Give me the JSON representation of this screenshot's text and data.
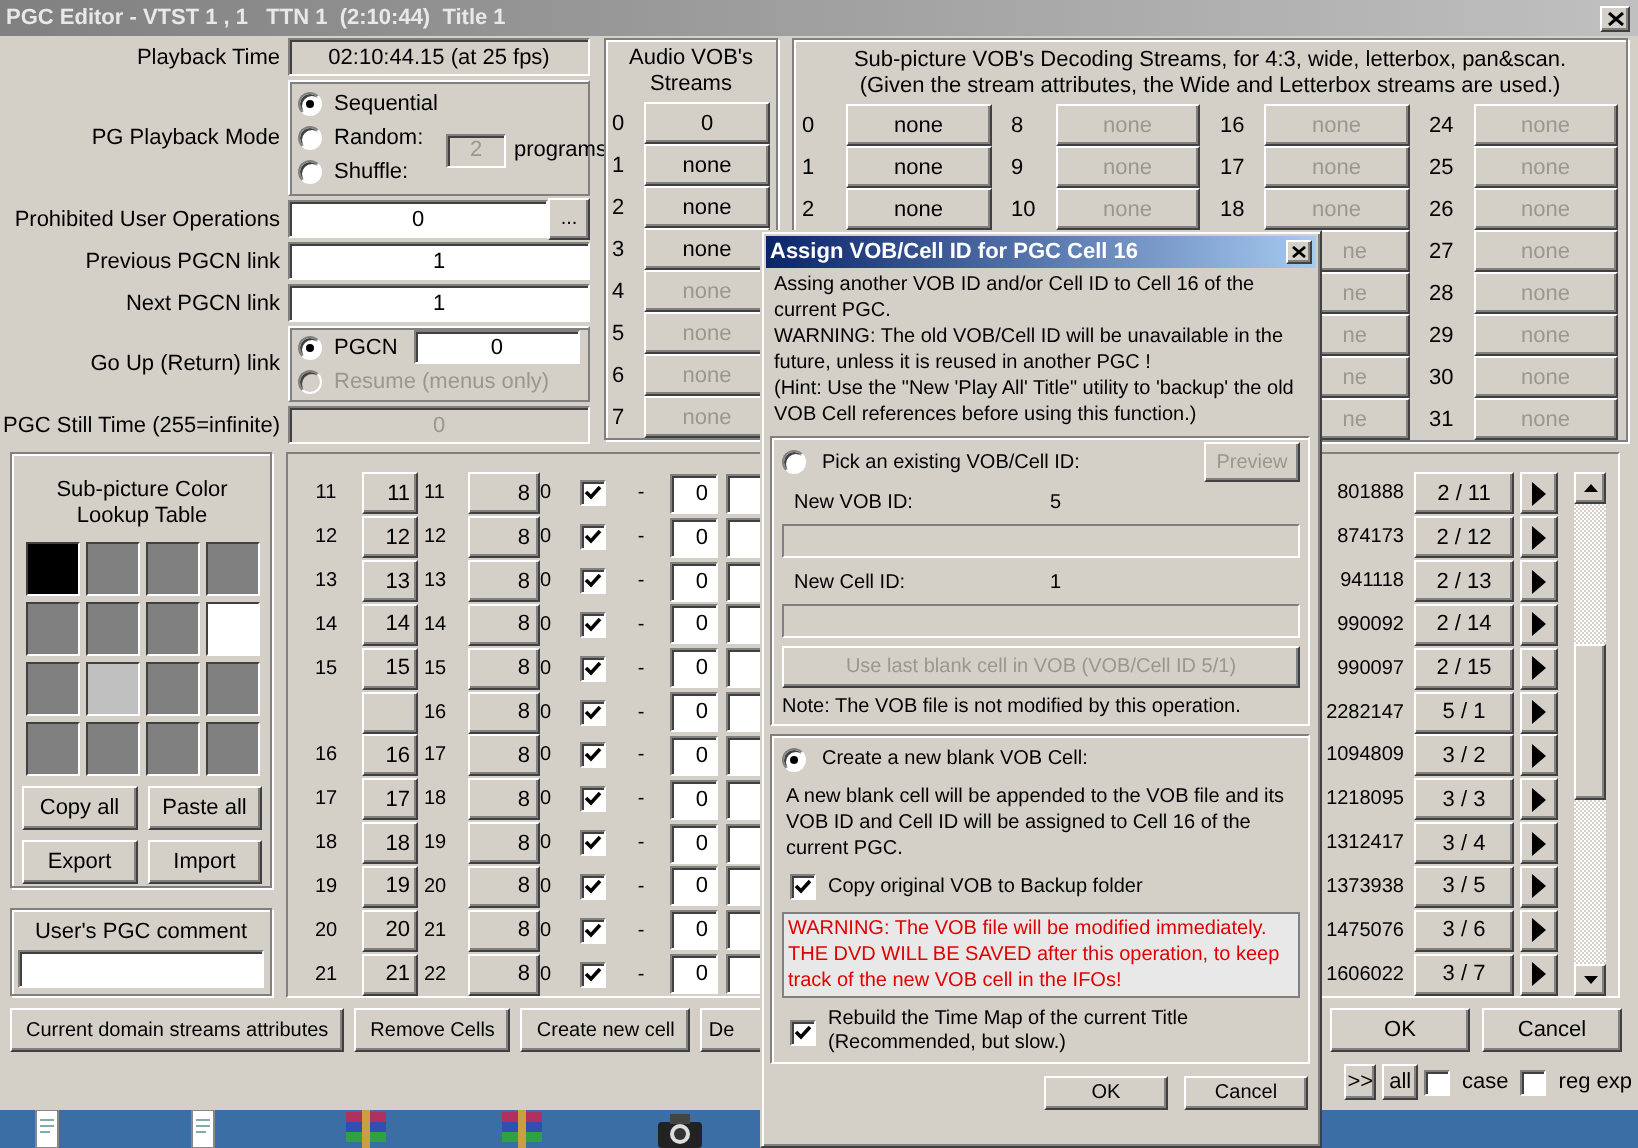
{
  "window": {
    "title": "PGC Editor - VTST 1 , 1   TTN 1  (2:10:44)  Title 1"
  },
  "properties": {
    "playback_time": {
      "label": "Playback Time",
      "value": "02:10:44.15 (at 25 fps)"
    },
    "playback_mode": {
      "label": "PG Playback Mode",
      "options": [
        {
          "label": "Sequential",
          "selected": true
        },
        {
          "label": "Random:",
          "selected": false
        },
        {
          "label": "Shuffle:",
          "selected": false
        }
      ],
      "programs": {
        "value": "2",
        "label": "programs",
        "disabled": true
      }
    },
    "prohibited_ops": {
      "label": "Prohibited User Operations",
      "value": "0",
      "button": "..."
    },
    "previous_link": {
      "label": "Previous PGCN link",
      "value": "1"
    },
    "next_link": {
      "label": "Next PGCN link",
      "value": "1"
    },
    "go_up": {
      "label": "Go Up (Return) link",
      "pgcn": {
        "label": "PGCN",
        "selected": true,
        "value": "0"
      },
      "resume": {
        "label": "Resume (menus only)",
        "selected": false,
        "disabled": true
      }
    },
    "still_time": {
      "label": "PGC Still Time (255=infinite)",
      "value": "0",
      "disabled": true
    }
  },
  "audio_streams": {
    "title": "Audio VOB's Streams",
    "streams": [
      {
        "index": "0",
        "label": "0",
        "disabled": false
      },
      {
        "index": "1",
        "label": "none",
        "disabled": false
      },
      {
        "index": "2",
        "label": "none",
        "disabled": false
      },
      {
        "index": "3",
        "label": "none",
        "disabled": false
      },
      {
        "index": "4",
        "label": "none",
        "disabled": true
      },
      {
        "index": "5",
        "label": "none",
        "disabled": true
      },
      {
        "index": "6",
        "label": "none",
        "disabled": true
      },
      {
        "index": "7",
        "label": "none",
        "disabled": true
      }
    ]
  },
  "subpicture_streams": {
    "title": "Sub-picture VOB's Decoding Streams, for 4:3, wide, letterbox, pan&scan.",
    "subtitle": "(Given the stream attributes, the Wide and Letterbox streams are used.)",
    "columns": [
      [
        {
          "kind": "button",
          "index": "0",
          "label": "none",
          "disabled": false
        },
        {
          "kind": "button",
          "index": "1",
          "label": "none",
          "disabled": false
        },
        {
          "kind": "button",
          "index": "2",
          "label": "none",
          "disabled": false
        }
      ],
      [
        {
          "kind": "button",
          "index": "8",
          "label": "none",
          "disabled": true
        },
        {
          "kind": "button",
          "index": "9",
          "label": "none",
          "disabled": true
        },
        {
          "kind": "button",
          "index": "10",
          "label": "none",
          "disabled": true
        }
      ],
      [
        {
          "kind": "button",
          "index": "16",
          "label": "none",
          "disabled": true
        },
        {
          "kind": "button",
          "index": "17",
          "label": "none",
          "disabled": true
        },
        {
          "kind": "button",
          "index": "18",
          "label": "none",
          "disabled": true
        },
        {
          "kind": "clipped",
          "label": "ne",
          "disabled": true
        },
        {
          "kind": "clipped",
          "label": "ne",
          "disabled": true
        },
        {
          "kind": "clipped",
          "label": "ne",
          "disabled": true
        },
        {
          "kind": "clipped",
          "label": "ne",
          "disabled": true
        },
        {
          "kind": "clipped",
          "label": "ne",
          "disabled": true
        }
      ],
      [
        {
          "kind": "button",
          "index": "24",
          "label": "none",
          "disabled": true
        },
        {
          "kind": "button",
          "index": "25",
          "label": "none",
          "disabled": true
        },
        {
          "kind": "button",
          "index": "26",
          "label": "none",
          "disabled": true
        },
        {
          "kind": "button",
          "index": "27",
          "label": "none",
          "disabled": true
        },
        {
          "kind": "button",
          "index": "28",
          "label": "none",
          "disabled": true
        },
        {
          "kind": "button",
          "index": "29",
          "label": "none",
          "disabled": true
        },
        {
          "kind": "button",
          "index": "30",
          "label": "none",
          "disabled": true
        },
        {
          "kind": "button",
          "index": "31",
          "label": "none",
          "disabled": true
        }
      ]
    ]
  },
  "color_table": {
    "title": "Sub-picture Color Lookup Table",
    "colors": [
      {
        "color": "#000000"
      },
      {
        "color": "#808080"
      },
      {
        "color": "#808080"
      },
      {
        "color": "#808080"
      },
      {
        "color": "#808080"
      },
      {
        "color": "#808080"
      },
      {
        "color": "#808080"
      },
      {
        "color": "#ffffff"
      },
      {
        "color": "#808080"
      },
      {
        "color": "#c0c0c0"
      },
      {
        "color": "#808080"
      },
      {
        "color": "#808080"
      },
      {
        "color": "#808080"
      },
      {
        "color": "#808080"
      },
      {
        "color": "#808080"
      },
      {
        "color": "#808080"
      }
    ],
    "buttons": [
      "Copy all",
      "Paste all",
      "Export",
      "Import"
    ]
  },
  "comment": {
    "label": "User's PGC comment"
  },
  "cells": [
    {
      "column_1": "11",
      "column_2": "11",
      "column_3": "11",
      "column_4": "8",
      "column_5": "0",
      "checked": true,
      "column_6": "-",
      "column_7": "0",
      "column_8": "801888",
      "column_9": "2 / 11"
    },
    {
      "column_1": "12",
      "column_2": "12",
      "column_3": "12",
      "column_4": "8",
      "column_5": "0",
      "checked": true,
      "column_6": "-",
      "column_7": "0",
      "column_8": "874173",
      "column_9": "2 / 12"
    },
    {
      "column_1": "13",
      "column_2": "13",
      "column_3": "13",
      "column_4": "8",
      "column_5": "0",
      "checked": true,
      "column_6": "-",
      "column_7": "0",
      "column_8": "941118",
      "column_9": "2 / 13"
    },
    {
      "column_1": "14",
      "column_2": "14",
      "column_3": "14",
      "column_4": "8",
      "column_5": "0",
      "checked": true,
      "column_6": "-",
      "column_7": "0",
      "column_8": "990092",
      "column_9": "2 / 14"
    },
    {
      "column_1": "15",
      "column_2": "15",
      "column_3": "15",
      "column_4": "8",
      "column_5": "0",
      "checked": true,
      "column_6": "-",
      "column_7": "0",
      "column_8": "990097",
      "column_9": "2 / 15"
    },
    {
      "column_3": "16",
      "column_4": "8",
      "column_5": "0",
      "checked": true,
      "column_6": "-",
      "column_7": "0",
      "column_8": "2282147",
      "column_9": "5 / 1"
    },
    {
      "column_1": "16",
      "column_2": "16",
      "column_3": "17",
      "column_4": "8",
      "column_5": "0",
      "checked": true,
      "column_6": "-",
      "column_7": "0",
      "column_8": "1094809",
      "column_9": "3 / 2"
    },
    {
      "column_1": "17",
      "column_2": "17",
      "column_3": "18",
      "column_4": "8",
      "column_5": "0",
      "checked": true,
      "column_6": "-",
      "column_7": "0",
      "column_8": "1218095",
      "column_9": "3 / 3"
    },
    {
      "column_1": "18",
      "column_2": "18",
      "column_3": "19",
      "column_4": "8",
      "column_5": "0",
      "checked": true,
      "column_6": "-",
      "column_7": "0",
      "column_8": "1312417",
      "column_9": "3 / 4"
    },
    {
      "column_1": "19",
      "column_2": "19",
      "column_3": "20",
      "column_4": "8",
      "column_5": "0",
      "checked": true,
      "column_6": "-",
      "column_7": "0",
      "column_8": "1373938",
      "column_9": "3 / 5"
    },
    {
      "column_1": "20",
      "column_2": "20",
      "column_3": "21",
      "column_4": "8",
      "column_5": "0",
      "checked": true,
      "column_6": "-",
      "column_7": "0",
      "column_8": "1475076",
      "column_9": "3 / 6"
    },
    {
      "column_1": "21",
      "column_2": "21",
      "column_3": "22",
      "column_4": "8",
      "column_5": "0",
      "checked": true,
      "column_6": "-",
      "column_7": "0",
      "column_8": "1606022",
      "column_9": "3 / 7"
    }
  ],
  "actions": [
    {
      "kind": "button",
      "label": "Current domain streams attributes"
    },
    {
      "kind": "button",
      "label": "Remove Cells"
    },
    {
      "kind": "button",
      "label": "Create new cell"
    },
    {
      "kind": "clipped",
      "label": "De"
    }
  ],
  "main_buttons": [
    "OK",
    "Cancel"
  ],
  "search": {
    "buttons": [
      ">>",
      "all"
    ],
    "options": [
      {
        "label": "case",
        "checked": false
      },
      {
        "label": "reg exp",
        "checked": false
      }
    ]
  },
  "taskbar": {
    "items": [
      {
        "kind": "document"
      },
      {
        "kind": "document"
      },
      {
        "kind": "archive"
      },
      {
        "kind": "archive"
      },
      {
        "kind": "camera"
      }
    ]
  },
  "dialog": {
    "title": "Assign VOB/Cell ID for PGC Cell 16",
    "intro": [
      "Assing another VOB ID and/or Cell ID to Cell 16 of the current PGC.",
      "WARNING: The old VOB/Cell ID will be unavailable in the future, unless it is reused in another PGC !",
      "(Hint: Use the \"New 'Play All' Title\" utility to 'backup' the old VOB Cell references before using this function.)"
    ],
    "pick": {
      "label": "Pick an existing VOB/Cell ID:",
      "selected": false,
      "preview": {
        "label": "Preview",
        "disabled": true
      },
      "vob_label": "New VOB ID:",
      "vob_value": "5",
      "cell_label": "New Cell ID:",
      "cell_value": "1",
      "use_last": {
        "label": "Use last blank cell in VOB (VOB/Cell ID 5/1)",
        "disabled": true
      },
      "note": "Note: The VOB file is not modified by this operation."
    },
    "create": {
      "label": "Create a new blank VOB Cell:",
      "selected": true,
      "description": "A new blank cell will be appended to the VOB file and its VOB ID and Cell ID will be assigned to Cell 16 of the current PGC.",
      "backup": {
        "label": "Copy original VOB to Backup folder",
        "checked": true
      },
      "warning": "WARNING: The VOB file will be modified immediately. THE DVD WILL BE SAVED after this operation, to keep track of the new VOB cell in the IFOs!",
      "rebuild": {
        "label": "Rebuild the Time Map of the current Title\n(Recommended, but slow.)",
        "checked": true
      }
    },
    "buttons": [
      "OK",
      "Cancel"
    ]
  }
}
